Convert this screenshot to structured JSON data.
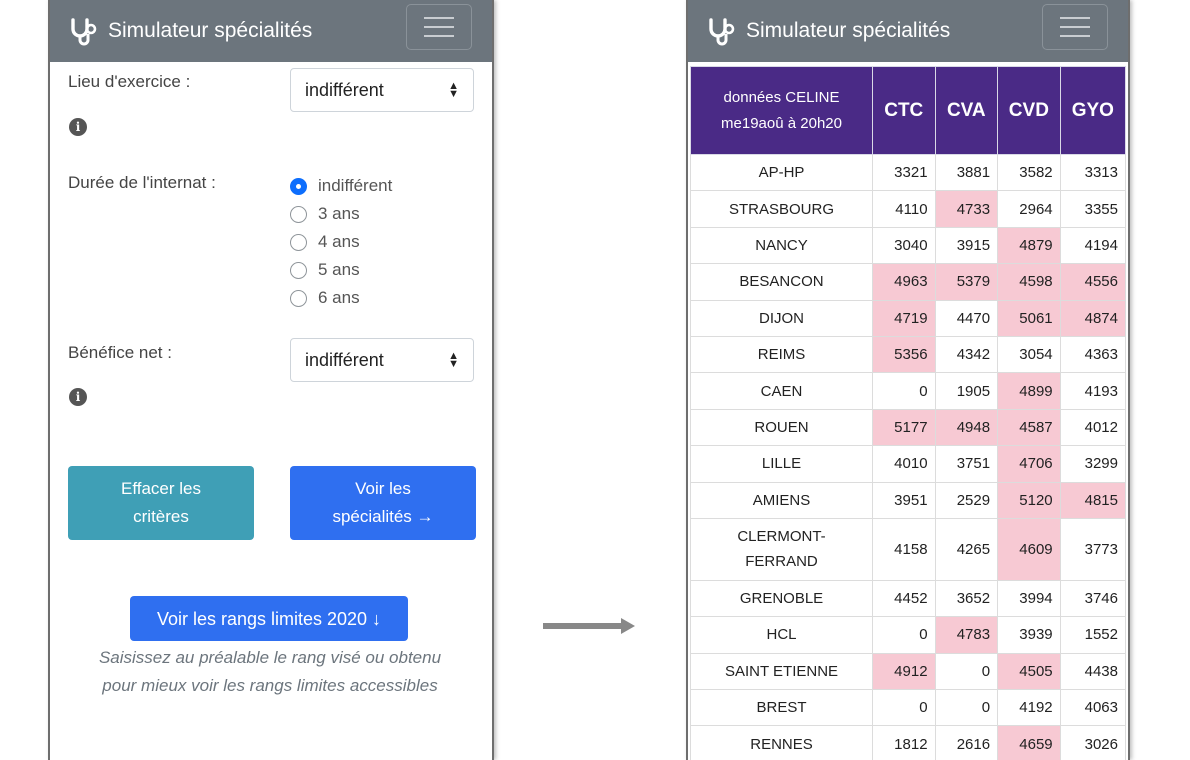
{
  "app": {
    "title": "Simulateur spécialités",
    "brand_icon": "stethoscope-icon",
    "menu_icon": "hamburger-menu-icon"
  },
  "form": {
    "lieu_label": "Lieu d'exercice :",
    "lieu_value": "indifférent",
    "duree_label": "Durée de l'internat :",
    "duree_options": [
      "indifférent",
      "3 ans",
      "4 ans",
      "5 ans",
      "6 ans"
    ],
    "duree_selected": "indifférent",
    "benefice_label": "Bénéfice net :",
    "benefice_value": "indifférent",
    "clear_button_line1": "Effacer les",
    "clear_button_line2": "critères",
    "spec_button_line1": "Voir les",
    "spec_button_line2": "spécialités →",
    "ranks_button": "Voir les rangs limites 2020 ↓",
    "hint_line1": "Saisissez au préalable le rang visé ou obtenu",
    "hint_line2": "pour mieux voir les rangs limites accessibles"
  },
  "table": {
    "header_line1": "données CELINE",
    "header_line2": "me19aoû à 20h20",
    "columns": [
      "CTC",
      "CVA",
      "CVD",
      "GYO"
    ],
    "rows": [
      {
        "name": "AP-HP",
        "values": [
          "3321",
          "3881",
          "3582",
          "3313"
        ],
        "highlight": [
          false,
          false,
          false,
          false
        ]
      },
      {
        "name": "STRASBOURG",
        "values": [
          "4110",
          "4733",
          "2964",
          "3355"
        ],
        "highlight": [
          false,
          true,
          false,
          false
        ]
      },
      {
        "name": "NANCY",
        "values": [
          "3040",
          "3915",
          "4879",
          "4194"
        ],
        "highlight": [
          false,
          false,
          true,
          false
        ]
      },
      {
        "name": "BESANCON",
        "values": [
          "4963",
          "5379",
          "4598",
          "4556"
        ],
        "highlight": [
          true,
          true,
          true,
          true
        ]
      },
      {
        "name": "DIJON",
        "values": [
          "4719",
          "4470",
          "5061",
          "4874"
        ],
        "highlight": [
          true,
          false,
          true,
          true
        ]
      },
      {
        "name": "REIMS",
        "values": [
          "5356",
          "4342",
          "3054",
          "4363"
        ],
        "highlight": [
          true,
          false,
          false,
          false
        ]
      },
      {
        "name": "CAEN",
        "values": [
          "0",
          "1905",
          "4899",
          "4193"
        ],
        "highlight": [
          false,
          false,
          true,
          false
        ]
      },
      {
        "name": "ROUEN",
        "values": [
          "5177",
          "4948",
          "4587",
          "4012"
        ],
        "highlight": [
          true,
          true,
          true,
          false
        ]
      },
      {
        "name": "LILLE",
        "values": [
          "4010",
          "3751",
          "4706",
          "3299"
        ],
        "highlight": [
          false,
          false,
          true,
          false
        ]
      },
      {
        "name": "AMIENS",
        "values": [
          "3951",
          "2529",
          "5120",
          "4815"
        ],
        "highlight": [
          false,
          false,
          true,
          true
        ]
      },
      {
        "name": "CLERMONT-FERRAND",
        "name_line1": "CLERMONT-",
        "name_line2": "FERRAND",
        "values": [
          "4158",
          "4265",
          "4609",
          "3773"
        ],
        "highlight": [
          false,
          false,
          true,
          false
        ]
      },
      {
        "name": "GRENOBLE",
        "values": [
          "4452",
          "3652",
          "3994",
          "3746"
        ],
        "highlight": [
          false,
          false,
          false,
          false
        ]
      },
      {
        "name": "HCL",
        "values": [
          "0",
          "4783",
          "3939",
          "1552"
        ],
        "highlight": [
          false,
          true,
          false,
          false
        ]
      },
      {
        "name": "SAINT ETIENNE",
        "values": [
          "4912",
          "0",
          "4505",
          "4438"
        ],
        "highlight": [
          true,
          false,
          true,
          false
        ]
      },
      {
        "name": "BREST",
        "values": [
          "0",
          "0",
          "4192",
          "4063"
        ],
        "highlight": [
          false,
          false,
          false,
          false
        ]
      },
      {
        "name": "RENNES",
        "values": [
          "1812",
          "2616",
          "4659",
          "3026"
        ],
        "highlight": [
          false,
          false,
          true,
          false
        ]
      }
    ]
  },
  "colors": {
    "navbar": "#6c757d",
    "table_header": "#4a2a86",
    "highlight": "#f7c9d3",
    "primary_button": "#2f6ff0",
    "info_button": "#3f9fb6"
  }
}
